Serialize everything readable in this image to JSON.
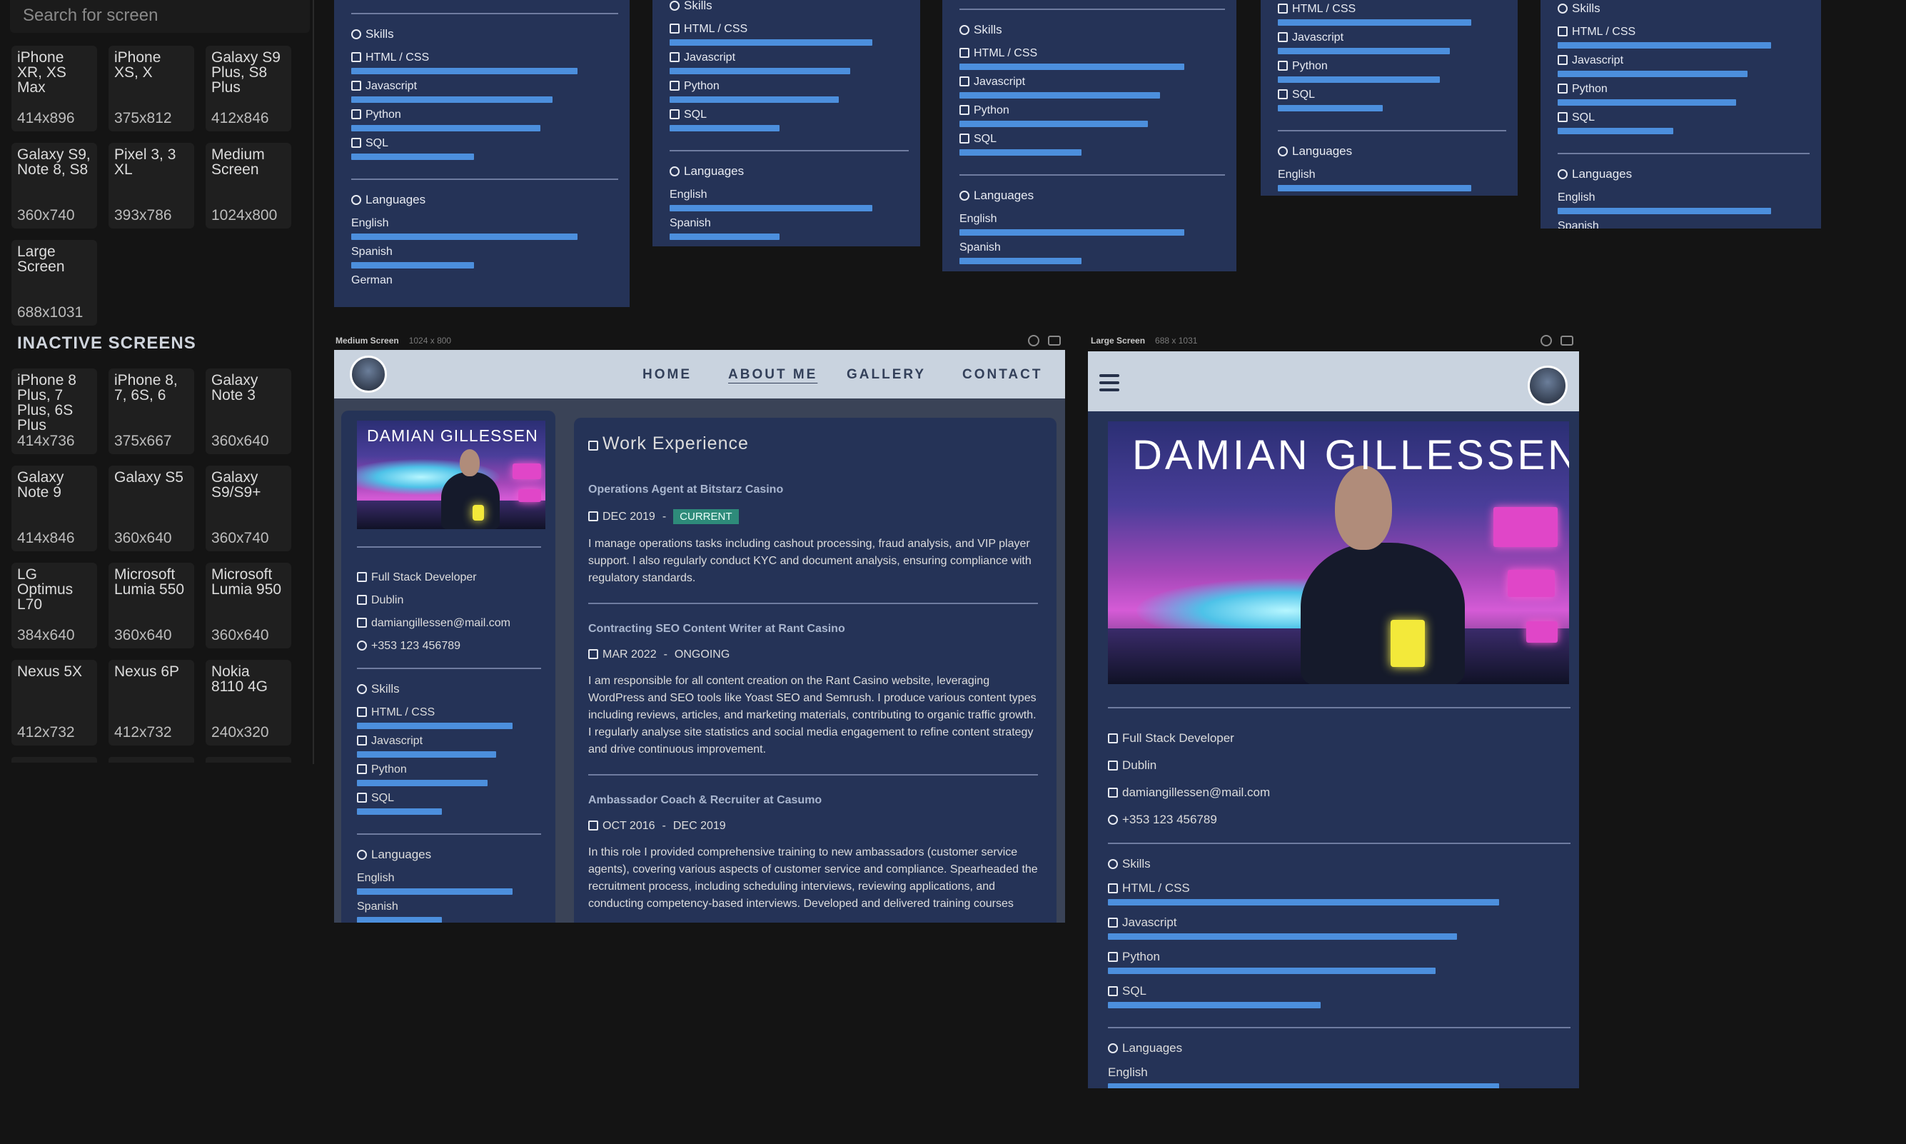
{
  "sidebar": {
    "search_placeholder": "Search for screen",
    "active_screens": [
      {
        "name": "iPhone XR, XS Max",
        "res": "414x896"
      },
      {
        "name": "iPhone XS, X",
        "res": "375x812"
      },
      {
        "name": "Galaxy S9 Plus, S8 Plus",
        "res": "412x846"
      },
      {
        "name": "Galaxy S9, Note 8, S8",
        "res": "360x740"
      },
      {
        "name": "Pixel 3, 3 XL",
        "res": "393x786"
      },
      {
        "name": "Medium Screen",
        "res": "1024x800"
      },
      {
        "name": "Large Screen",
        "res": "688x1031"
      }
    ],
    "inactive_title": "INACTIVE SCREENS",
    "inactive_screens": [
      {
        "name": "iPhone 8 Plus, 7 Plus, 6S Plus",
        "res": "414x736"
      },
      {
        "name": "iPhone 8, 7, 6S, 6",
        "res": "375x667"
      },
      {
        "name": "Galaxy Note 3",
        "res": "360x640"
      },
      {
        "name": "Galaxy Note 9",
        "res": "414x846"
      },
      {
        "name": "Galaxy S5",
        "res": "360x640"
      },
      {
        "name": "Galaxy S9/S9+",
        "res": "360x740"
      },
      {
        "name": "LG Optimus L70",
        "res": "384x640"
      },
      {
        "name": "Microsoft Lumia 550",
        "res": "360x640"
      },
      {
        "name": "Microsoft Lumia 950",
        "res": "360x640"
      },
      {
        "name": "Nexus 5X",
        "res": "412x732"
      },
      {
        "name": "Nexus 6P",
        "res": "412x732"
      },
      {
        "name": "Nokia 8110 4G",
        "res": "240x320"
      }
    ]
  },
  "resume": {
    "skills_title": "Skills",
    "skills": [
      {
        "label": "HTML / CSS",
        "level": 0.92
      },
      {
        "label": "Javascript",
        "level": 0.82
      },
      {
        "label": "Python",
        "level": 0.77
      },
      {
        "label": "SQL",
        "level": 0.5
      }
    ],
    "languages_title": "Languages",
    "languages": [
      "English",
      "Spanish",
      "German"
    ],
    "lang_levels": [
      0.92,
      0.5
    ],
    "name": "DAMIAN GILLESSEN",
    "title": "Full Stack Developer",
    "city": "Dublin",
    "email": "damiangillessen@mail.com",
    "phone": "+353 123 456789"
  },
  "medium": {
    "header": "Medium Screen",
    "dims": "1024 x 800",
    "nav": [
      "HOME",
      "ABOUT ME",
      "GALLERY",
      "CONTACT"
    ],
    "active_nav": "ABOUT ME",
    "section_title": "Work Experience",
    "jobs": [
      {
        "title": "Operations Agent at Bitstarz Casino",
        "start": "DEC  2019",
        "sep": "-",
        "end": "",
        "badge": "CURRENT",
        "desc": "I manage operations tasks including cashout processing, fraud analysis, and VIP player support. I also regularly conduct KYC and document analysis, ensuring compliance with regulatory standards."
      },
      {
        "title": "Contracting SEO Content Writer at Rant Casino",
        "start": "MAR  2022",
        "sep": "-",
        "end": "ONGOING",
        "badge": "",
        "desc": "I am responsible for all content creation on the Rant Casino website, leveraging WordPress and SEO tools like Yoast SEO and Semrush. I produce various content types including reviews, articles, and marketing materials, contributing to organic traffic growth. I regularly analyse site statistics and social media engagement to refine content strategy and drive continuous improvement."
      },
      {
        "title": "Ambassador Coach & Recruiter at Casumo",
        "start": "OCT  2016",
        "sep": "-",
        "end": "DEC  2019",
        "badge": "",
        "desc": "In this role I provided comprehensive training to new ambassadors (customer service agents), covering various aspects of customer service and compliance. Spearheaded the recruitment process, including scheduling interviews, reviewing applications, and conducting competency-based interviews. Developed and delivered training courses"
      }
    ]
  },
  "large": {
    "header": "Large Screen",
    "dims": "688 x 1031"
  },
  "colors": {
    "panel": "#253357",
    "bar": "#4c8fdd",
    "nav": "#c9d3df",
    "badge": "#2e8b7a",
    "page": "#141414"
  }
}
